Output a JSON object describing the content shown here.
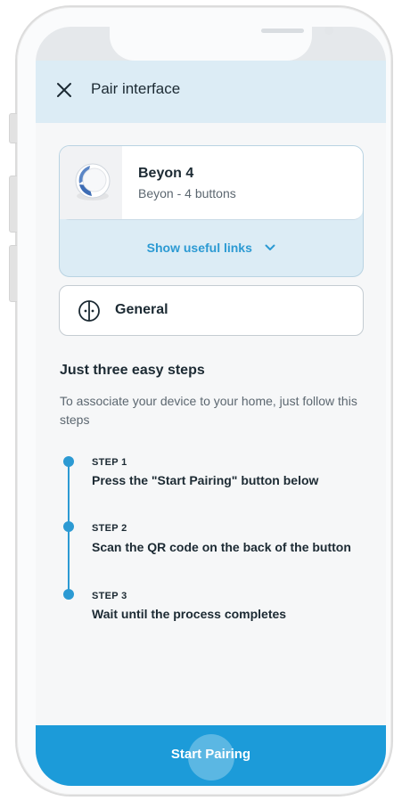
{
  "header": {
    "title": "Pair interface"
  },
  "device": {
    "name": "Beyon 4",
    "subtitle": "Beyon - 4 buttons",
    "links_label": "Show useful links"
  },
  "category": {
    "label": "General"
  },
  "steps_section": {
    "title": "Just three easy steps",
    "description": "To associate your device to your home, just follow this steps",
    "steps": [
      {
        "number": "STEP 1",
        "text": "Press the \"Start Pairing\" button below"
      },
      {
        "number": "STEP 2",
        "text": "Scan the QR code on the back of the button"
      },
      {
        "number": "STEP 3",
        "text": "Wait until the process completes"
      }
    ]
  },
  "footer": {
    "button_label": "Start Pairing"
  },
  "colors": {
    "accent": "#2c9ad3",
    "button_bg": "#1c9bd9",
    "header_bg": "#dcecf5"
  },
  "icons": [
    "close-icon",
    "device-image",
    "chevron-down-icon",
    "general-category-icon"
  ]
}
